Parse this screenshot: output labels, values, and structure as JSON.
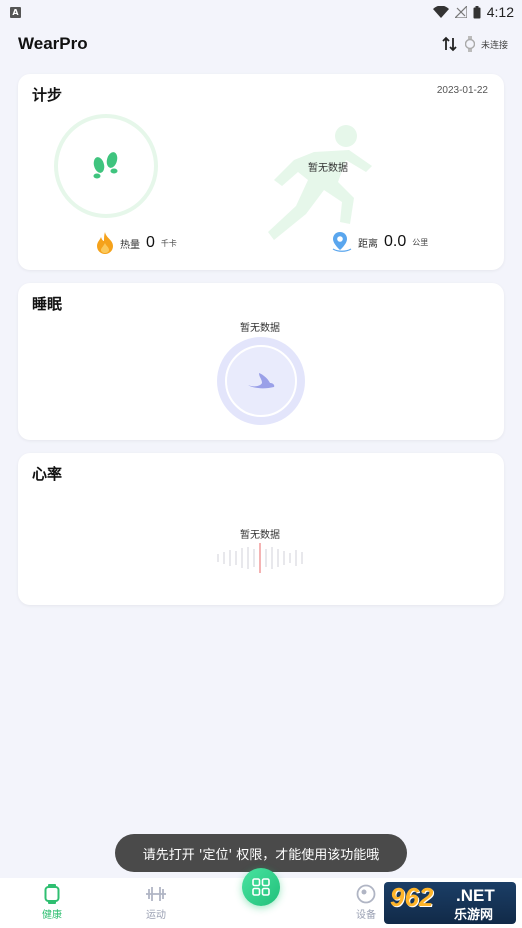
{
  "status_bar": {
    "time": "4:12",
    "app_icon_letter": "A"
  },
  "header": {
    "title": "WearPro",
    "connection_status": "未连接"
  },
  "steps_card": {
    "title": "计步",
    "date": "2023-01-22",
    "no_data": "暂无数据",
    "calories": {
      "label": "热量",
      "value": "0",
      "unit": "千卡"
    },
    "distance": {
      "label": "距离",
      "value": "0.0",
      "unit": "公里"
    }
  },
  "sleep_card": {
    "title": "睡眠",
    "no_data": "暂无数据"
  },
  "heart_card": {
    "title": "心率",
    "no_data": "暂无数据"
  },
  "toast": {
    "message": "请先打开 '定位' 权限，才能使用该功能哦"
  },
  "bottom_nav": {
    "items": [
      {
        "label": "健康",
        "icon": "watch-icon",
        "active": true
      },
      {
        "label": "运动",
        "icon": "dumbbell-icon",
        "active": false
      },
      {
        "label": "",
        "icon": "apps-icon",
        "active": false
      },
      {
        "label": "设备",
        "icon": "device-icon",
        "active": false
      }
    ]
  },
  "watermark": {
    "number": "962",
    "suffix": ".NET",
    "site": "乐游网"
  },
  "colors": {
    "accent": "#2fbf71",
    "background": "#f3f4fb",
    "sleep": "#e3e5fb",
    "toast": "#4a4a4a"
  }
}
